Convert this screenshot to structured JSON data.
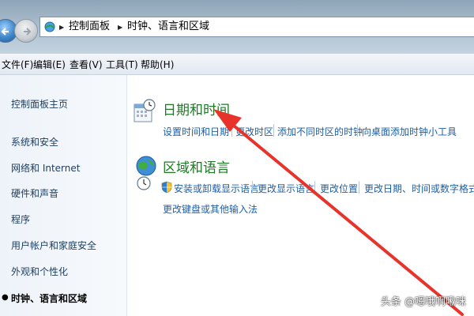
{
  "address_bar": {
    "crumbs": [
      "控制面板",
      "时钟、语言和区域"
    ]
  },
  "menu": {
    "items": [
      "文件(F)",
      "编辑(E)",
      "查看(V)",
      "工具(T)",
      "帮助(H)"
    ]
  },
  "sidebar": {
    "items": [
      {
        "label": "控制面板主页"
      },
      {
        "label": "系统和安全"
      },
      {
        "label": "网络和 Internet"
      },
      {
        "label": "硬件和声音"
      },
      {
        "label": "程序"
      },
      {
        "label": "用户帐户和家庭安全"
      },
      {
        "label": "外观和个性化"
      },
      {
        "label": "时钟、语言和区域"
      }
    ]
  },
  "categories": [
    {
      "title": "日期和时间",
      "icon": "clock-calendar-icon",
      "links": [
        "设置时间和日期",
        "更改时区",
        "添加不同时区的时钟",
        "向桌面添加时钟小工具"
      ]
    },
    {
      "title": "区域和语言",
      "icon": "globe-clock-icon",
      "links": [
        "安装或卸载显示语言",
        "更改显示语言",
        "更改位置",
        "更改日期、时间或数字格式",
        "更改键盘或其他输入法"
      ]
    }
  ],
  "watermark": {
    "text": "头条 @嗯哦啊啾咪"
  },
  "colors": {
    "heading": "#1e7a25",
    "link": "#1d5fa8",
    "annotation_arrow": "#e8332a"
  }
}
